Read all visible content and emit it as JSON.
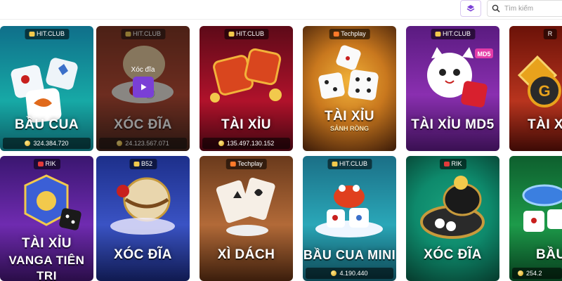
{
  "topbar": {
    "search_placeholder": "Tìm kiếm",
    "filter_icon": "layers-filter-icon",
    "search_icon": "search-icon"
  },
  "hover": {
    "label": "Xóc đĩa",
    "play_icon": "play-icon"
  },
  "games": [
    {
      "title": "BẦU CUA",
      "provider": "HIT.CLUB",
      "jackpot": "324.384.720",
      "bg": "#17a9a6"
    },
    {
      "title": "XÓC ĐĨA",
      "provider": "HIT.CLUB",
      "jackpot": "24.123.567.071",
      "bg": "#b6422a"
    },
    {
      "title": "TÀI XỈU",
      "provider": "HIT.CLUB",
      "jackpot": "135.497.130.152",
      "bg": "#b0122b"
    },
    {
      "title": "TÀI XỈU",
      "subtitle": "SẢNH RỒNG",
      "provider": "Techplay",
      "bg": "#c9781e"
    },
    {
      "title": "TÀI XỈU MD5",
      "provider": "HIT.CLUB",
      "bg": "#8a2fb0"
    },
    {
      "title": "TÀI XỈ",
      "provider": "R",
      "bg": "#b8341e"
    },
    {
      "title": "TÀI XỈU",
      "title2": "VANGA TIÊN TRI",
      "provider": "RIK",
      "bg": "#6f2bb0"
    },
    {
      "title": "XÓC ĐĨA",
      "provider": "B52",
      "bg": "#3a53c4"
    },
    {
      "title": "XÌ DÁCH",
      "provider": "Techplay",
      "bg": "#b26a38"
    },
    {
      "title": "BẦU CUA MINI",
      "provider": "HIT.CLUB",
      "jackpot": "4.190.440",
      "bg": "#2aa7b8"
    },
    {
      "title": "XÓC ĐĨA",
      "provider": "RIK",
      "bg": "#0e8a6c"
    },
    {
      "title": "BẦU",
      "provider": "",
      "jackpot": "254.2",
      "bg": "#1d9b4a"
    }
  ]
}
